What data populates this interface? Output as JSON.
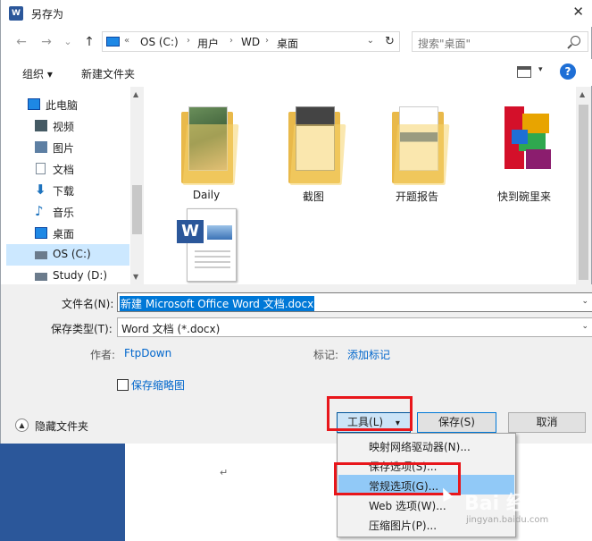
{
  "window": {
    "title": "另存为",
    "app_icon_letter": "W",
    "close_glyph": "✕"
  },
  "nav": {
    "back": "←",
    "forward": "→",
    "recent": "⌄",
    "up": "↑",
    "refresh": "↻"
  },
  "address": {
    "prefix": "«",
    "crumbs": [
      "OS (C:)",
      "用户",
      "WD",
      "桌面"
    ],
    "separator": "›",
    "dropdown": "⌄"
  },
  "search": {
    "placeholder": "搜索\"桌面\""
  },
  "toolbar": {
    "organize": "组织 ▾",
    "new_folder": "新建文件夹",
    "view_dd": "▾",
    "help": "?"
  },
  "navpane": {
    "items": [
      {
        "label": "此电脑",
        "icon": "computer-icon",
        "color": "#1e88e5"
      },
      {
        "label": "视频",
        "icon": "video-icon",
        "color": "#455a64"
      },
      {
        "label": "图片",
        "icon": "pictures-icon",
        "color": "#5d7fa3"
      },
      {
        "label": "文档",
        "icon": "documents-icon",
        "color": "#7d8b99"
      },
      {
        "label": "下载",
        "icon": "download-icon",
        "color": "#1e73be"
      },
      {
        "label": "音乐",
        "icon": "music-icon",
        "color": "#1e73be"
      },
      {
        "label": "桌面",
        "icon": "desktop-icon",
        "color": "#1e88e5"
      },
      {
        "label": "OS (C:)",
        "icon": "drive-c-icon",
        "color": "#6b7b8c",
        "selected": true
      },
      {
        "label": "Study (D:)",
        "icon": "drive-d-icon",
        "color": "#6b7b8c"
      }
    ]
  },
  "files": [
    {
      "label": "Daily",
      "type": "folder"
    },
    {
      "label": "截图",
      "type": "folder"
    },
    {
      "label": "开题报告",
      "type": "folder"
    },
    {
      "label": "快到碗里来",
      "type": "app"
    },
    {
      "label": "",
      "type": "word-doc",
      "doc_letter": "W"
    }
  ],
  "form": {
    "filename_label": "文件名(N):",
    "filename_value": "新建 Microsoft Office Word 文档.docx",
    "filetype_label": "保存类型(T):",
    "filetype_value": "Word 文档 (*.docx)",
    "author_label": "作者:",
    "author_value": "FtpDown",
    "tags_label": "标记:",
    "tags_value": "添加标记",
    "thumbnail_label": "保存缩略图",
    "dropdown_arrow": "⌄"
  },
  "footer": {
    "hide_folders": "隐藏文件夹",
    "hide_folders_glyph": "▲",
    "tools": "工具(L)",
    "tools_arrow": "▾",
    "save": "保存(S)",
    "cancel": "取消"
  },
  "menu": {
    "items": [
      {
        "label": "映射网络驱动器(N)..."
      },
      {
        "label": "保存选项(S)..."
      },
      {
        "label": "常规选项(G)...",
        "highlight": true
      },
      {
        "label": "Web 选项(W)..."
      },
      {
        "label": "压缩图片(P)..."
      }
    ]
  },
  "document": {
    "return_mark": "↵"
  },
  "watermark": {
    "text": "Bai 经验",
    "sub": "jingyan.baidu.com"
  },
  "colors": {
    "accent": "#0078d7",
    "highlight_red": "#e8161b",
    "menu_hover": "#91c9f7",
    "word_blue": "#2b579a"
  }
}
